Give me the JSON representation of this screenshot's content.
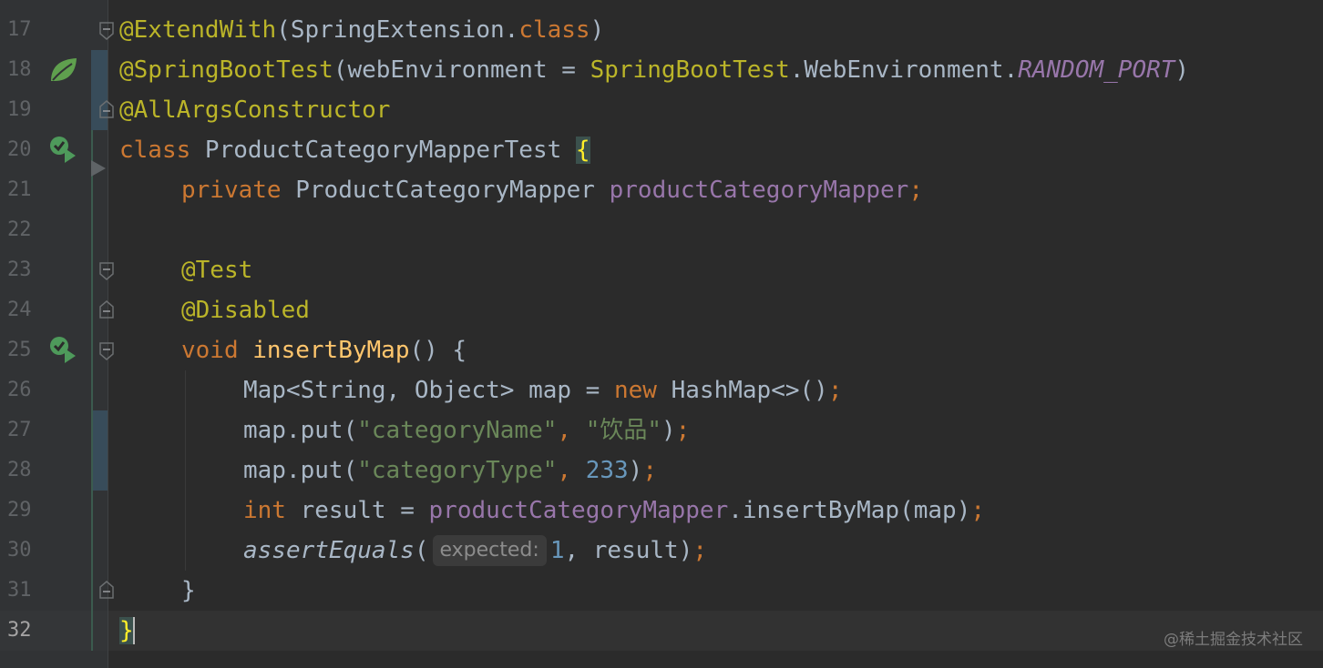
{
  "editor": {
    "line_numbers": [
      "17",
      "18",
      "19",
      "20",
      "21",
      "22",
      "23",
      "24",
      "25",
      "26",
      "27",
      "28",
      "29",
      "30",
      "31",
      "32"
    ],
    "current_line": "32",
    "watermark": "@稀土掘金技术社区",
    "gutter_icons": {
      "spring_bean": "spring-leaf-icon",
      "run_test": "run-test-icon"
    },
    "colors": {
      "background": "#2b2b2b",
      "keyword": "#cc7832",
      "annotation": "#bbb529",
      "string": "#6a8759",
      "number": "#6897bb",
      "field": "#9876aa",
      "method": "#ffc66d",
      "text": "#a9b7c6"
    },
    "code": {
      "l17": {
        "ann": "@ExtendWith",
        "open": "(",
        "cls": "SpringExtension",
        "dot": ".",
        "kw": "class",
        "close": ")"
      },
      "l18": {
        "ann": "@SpringBootTest",
        "open": "(",
        "param": "webEnvironment",
        "eq": " = ",
        "cls": "SpringBootTest",
        "dot1": ".",
        "inner": "WebEnvironment",
        "dot2": ".",
        "const": "RANDOM_PORT",
        "close": ")"
      },
      "l19": {
        "ann": "@AllArgsConstructor"
      },
      "l20": {
        "kw": "class",
        "name": " ProductCategoryMapperTest ",
        "brace": "{"
      },
      "l21": {
        "kw": "private",
        "type": " ProductCategoryMapper ",
        "field": "productCategoryMapper",
        "semi": ";"
      },
      "l23": {
        "ann": "@Test"
      },
      "l24": {
        "ann": "@Disabled"
      },
      "l25": {
        "kw": "void",
        "method": "insertByMap",
        "rest": "() {"
      },
      "l26": {
        "decl": "Map<String, Object> map = ",
        "kw": "new",
        "rest": " HashMap<>()",
        "semi": ";"
      },
      "l27": {
        "call": "map.put(",
        "str1": "\"categoryName\"",
        "comma": ", ",
        "str2": "\"饮品\"",
        "close": ")",
        "semi": ";"
      },
      "l28": {
        "call": "map.put(",
        "str1": "\"categoryType\"",
        "comma": ", ",
        "num": "233",
        "close": ")",
        "semi": ";"
      },
      "l29": {
        "kw": "int",
        "decl": " result = ",
        "field": "productCategoryMapper",
        "call": ".insertByMap(map)",
        "semi": ";"
      },
      "l30": {
        "method": "assertEquals",
        "open": "(",
        "hint": "expected:",
        "num": "1",
        "rest": ", result)",
        "semi": ";"
      },
      "l31": {
        "brace": "}"
      },
      "l32": {
        "brace": "}"
      }
    }
  }
}
